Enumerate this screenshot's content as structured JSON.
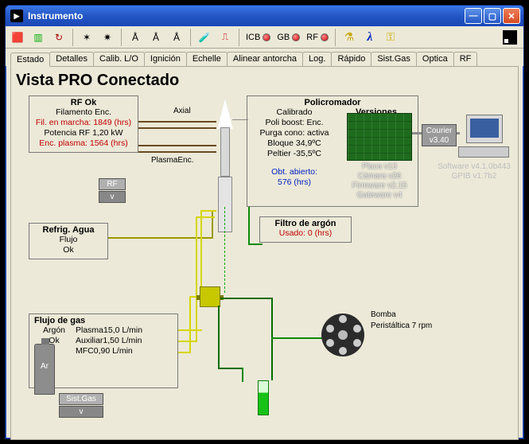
{
  "window": {
    "title": "Instrumento"
  },
  "toolbar_labels": {
    "icb": "ICB",
    "gb": "GB",
    "rf": "RF"
  },
  "tabs": [
    {
      "label": "Estado"
    },
    {
      "label": "Detalles"
    },
    {
      "label": "Calib. L/O"
    },
    {
      "label": "Ignición"
    },
    {
      "label": "Echelle"
    },
    {
      "label": "Alinear antorcha"
    },
    {
      "label": "Log."
    },
    {
      "label": "Rápido"
    },
    {
      "label": "Sist.Gas"
    },
    {
      "label": "Optica"
    },
    {
      "label": "RF"
    }
  ],
  "page_title": "Vista PRO Conectado",
  "rf": {
    "title": "RF Ok",
    "line1": "Filamento Enc.",
    "line2": "Fil. en marcha: 1849 (hrs)",
    "line3": "Potencia RF 1,20 kW",
    "line4": "Enc. plasma: 1564 (hrs)",
    "btn1": "RF",
    "btn2": "v"
  },
  "labels": {
    "axial": "Axial",
    "plasma": "PlasmaEnc."
  },
  "poly": {
    "title": "Policromador",
    "line1": "Calibrado",
    "line2": "Poli boost: Enc.",
    "line3": "Purga cono: activa",
    "line4": "Bloque 34,9ºC",
    "line5": "Peltier -35,5ºC",
    "versiones": "Versiones",
    "board": {
      "l1": "Placa v13",
      "l2": "Cámara v26",
      "l3": "Firmware v2.15",
      "l4": "Gateware v4"
    },
    "obt1": "Obt. abierto:",
    "obt2": "576 (hrs)"
  },
  "courier": {
    "l1": "Courier",
    "l2": "v3.40"
  },
  "pc": {
    "l1": "Software v4.1.0b443",
    "l2": "GPIB v1.7b2"
  },
  "refrig": {
    "title": "Refrig. Agua",
    "l1": "Flujo",
    "l2": "Ok"
  },
  "argon_filter": {
    "title": "Filtro de argón",
    "l1": "Usado: 0 (hrs)"
  },
  "gas": {
    "title": "Flujo de gas",
    "l1": "Argón",
    "l2": "Ok",
    "l3": "Plasma15,0 L/min",
    "l4": "Auxiliar1,50 L/min",
    "l5": "MFC0,90 L/min",
    "cyl": "Ar",
    "btn1": "Sist.Gas",
    "btn2": "v"
  },
  "pump": {
    "l1": "Bomba",
    "l2": "Peristáltica 7 rpm"
  }
}
